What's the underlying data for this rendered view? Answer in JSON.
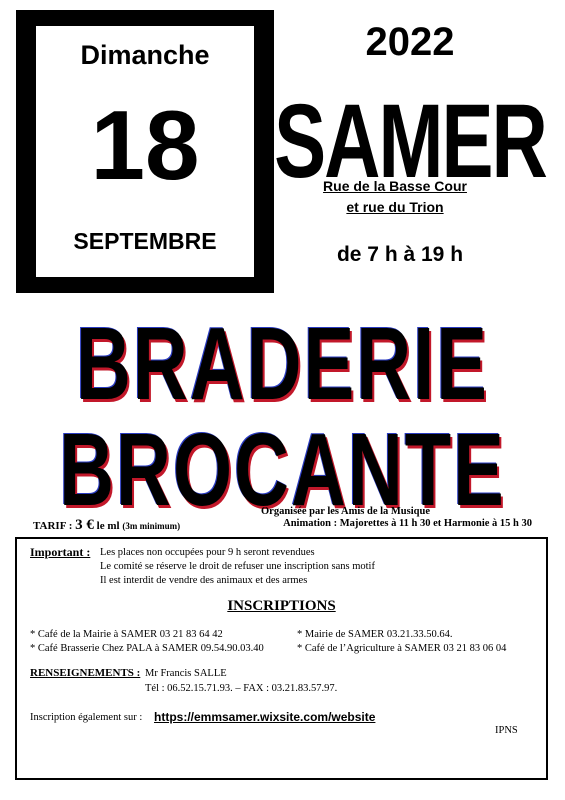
{
  "date": {
    "day": "Dimanche",
    "number": "18",
    "month": "SEPTEMBRE"
  },
  "year": "2022",
  "town": "SAMER",
  "address": {
    "line1": "Rue de la Basse Cour",
    "line2": "et rue du Trion"
  },
  "hours": "de 7 h à 19 h",
  "title": {
    "line1": "BRADERIE",
    "line2": "BROCANTE"
  },
  "organizer": "Organisée par les Amis de la Musique",
  "tarif": {
    "label": "TARIF :",
    "value": "3 €",
    "unit": "le ml",
    "note": "(3m minimum)"
  },
  "animation": "Animation : Majorettes à 11 h 30 et Harmonie à 15 h 30",
  "important": {
    "label": "Important :",
    "lines": [
      "Les places non occupées pour 9 h seront revendues",
      "Le comité se réserve le droit de refuser une inscription sans motif",
      "Il est interdit de vendre des animaux et des armes"
    ]
  },
  "inscriptions": {
    "title": "INSCRIPTIONS",
    "left": [
      "* Café de la Mairie à SAMER 03 21 83 64 42",
      "* Café Brasserie Chez PALA à SAMER 09.54.90.03.40"
    ],
    "right": [
      "* Mairie de SAMER 03.21.33.50.64.",
      "* Café de l’Agriculture à SAMER 03 21 83 06 04"
    ]
  },
  "renseignements": {
    "label": "RENSEIGNEMENTS :",
    "name": "Mr Francis SALLE",
    "phone": "Tél : 06.52.15.71.93.  – FAX : 03.21.83.57.97."
  },
  "web": {
    "label": "Inscription également sur :",
    "url": "https://emmsamer.wixsite.com/website"
  },
  "footer": "IPNS"
}
